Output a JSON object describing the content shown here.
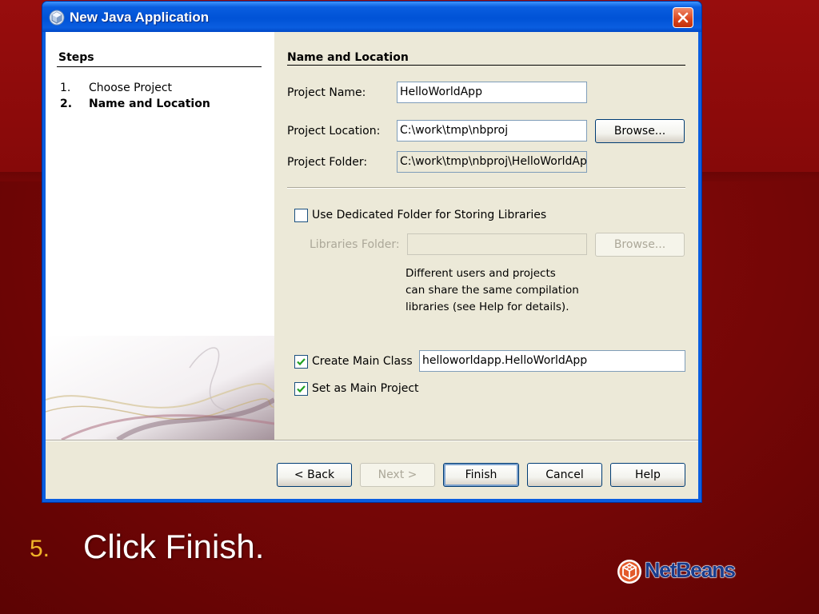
{
  "window": {
    "title": "New Java Application"
  },
  "steps": {
    "heading": "Steps",
    "items": [
      {
        "num": "1.",
        "label": "Choose Project"
      },
      {
        "num": "2.",
        "label": "Name and Location"
      }
    ]
  },
  "form": {
    "heading": "Name and Location",
    "project_name_label": "Project Name:",
    "project_name_value": "HelloWorldApp",
    "project_location_label": "Project Location:",
    "project_location_value": "C:\\work\\tmp\\nbproj",
    "browse_label": "Browse...",
    "project_folder_label": "Project Folder:",
    "project_folder_value": "C:\\work\\tmp\\nbproj\\HelloWorldAp",
    "dedicated_folder_label": "Use Dedicated Folder for Storing Libraries",
    "dedicated_folder_checked": false,
    "libraries_folder_label": "Libraries Folder:",
    "libraries_folder_value": "",
    "libraries_browse_label": "Browse...",
    "help_line1": "Different users and projects",
    "help_line2": "can share the same compilation",
    "help_line3": "libraries (see Help for details).",
    "create_main_class_label": "Create Main Class",
    "create_main_class_checked": true,
    "main_class_value": "helloworldapp.HelloWorldApp",
    "set_main_project_label": "Set as Main Project",
    "set_main_project_checked": true
  },
  "buttons": {
    "back": "< Back",
    "next": "Next >",
    "finish": "Finish",
    "cancel": "Cancel",
    "help": "Help"
  },
  "slide": {
    "step_number": "5.",
    "instruction": "Click Finish.",
    "logo_text": "NetBeans"
  },
  "colors": {
    "titlebar": "#0a5ee0",
    "dialog_bg": "#ece9d8",
    "slide_bg": "#7a0707",
    "step_number": "#f0b428"
  }
}
